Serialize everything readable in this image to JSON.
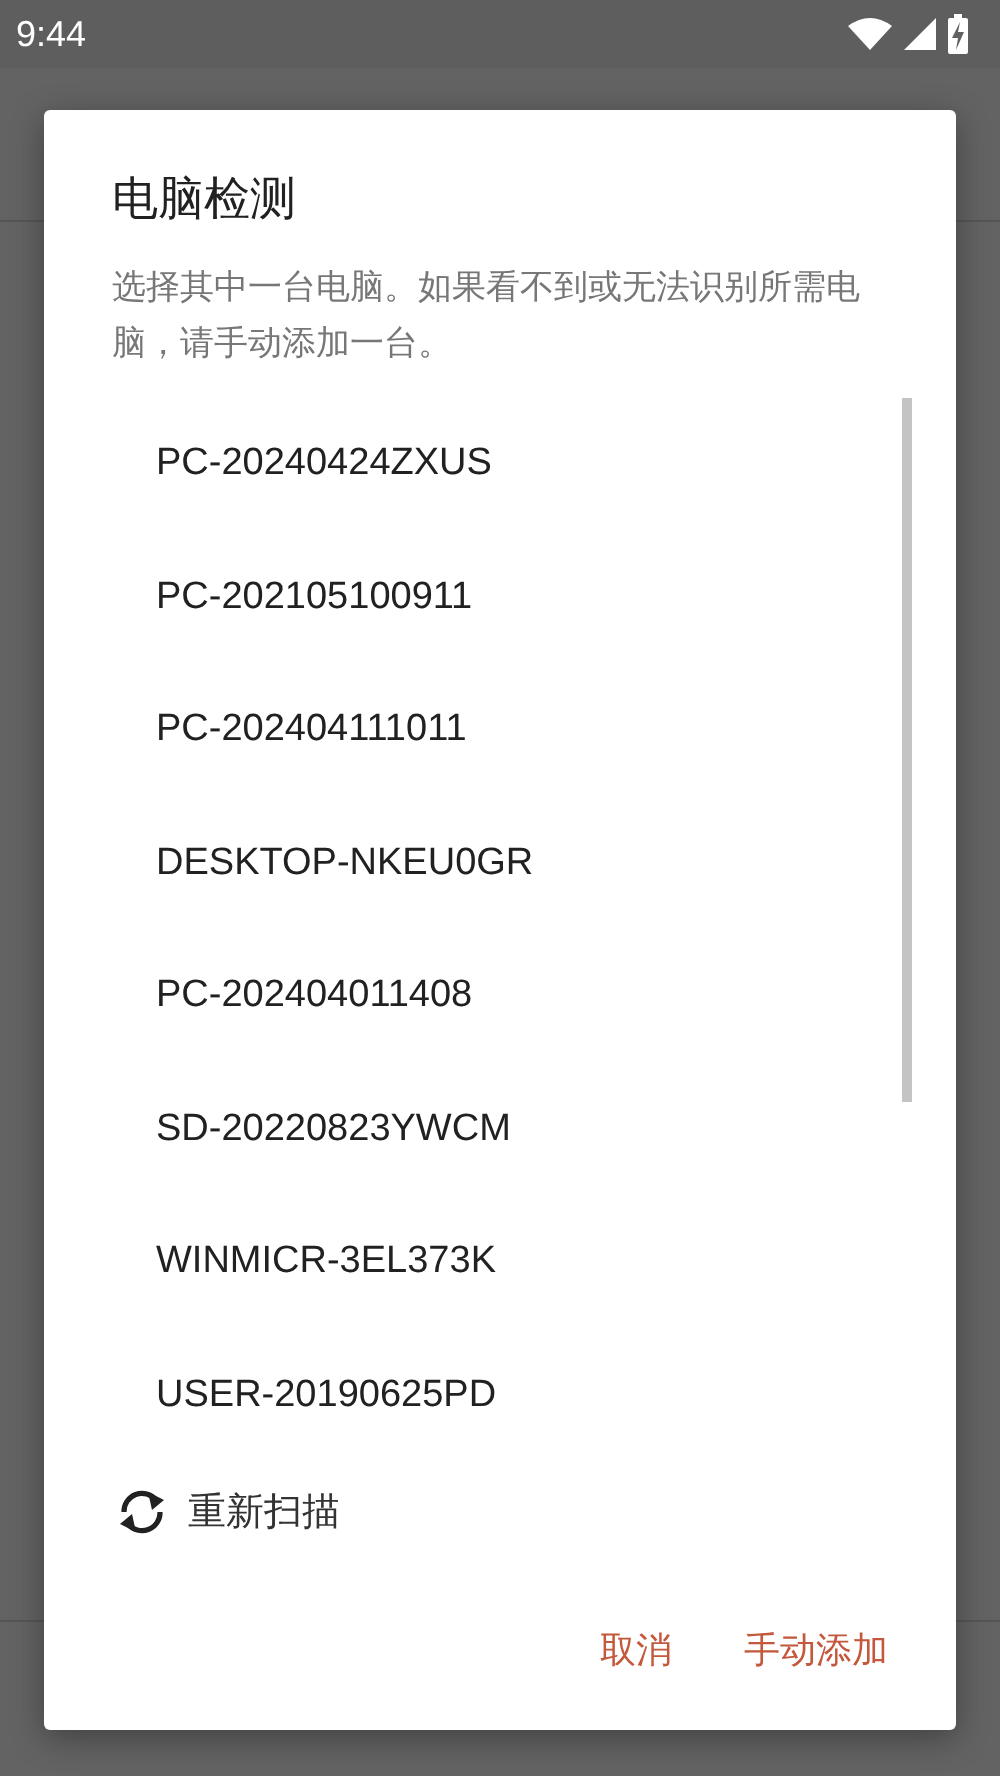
{
  "status_bar": {
    "time": "9:44"
  },
  "dialog": {
    "title": "电脑检测",
    "message": "选择其中一台电脑。如果看不到或无法识别所需电脑，请手动添加一台。",
    "computers": [
      "PC-20240424ZXUS",
      "PC-202105100911",
      "PC-202404111011",
      "DESKTOP-NKEU0GR",
      "PC-202404011408",
      "SD-20220823YWCM",
      "WINMICR-3EL373K",
      "USER-20190625PD"
    ],
    "rescan": "重新扫描",
    "buttons": [
      "取消",
      "手动添加"
    ]
  }
}
